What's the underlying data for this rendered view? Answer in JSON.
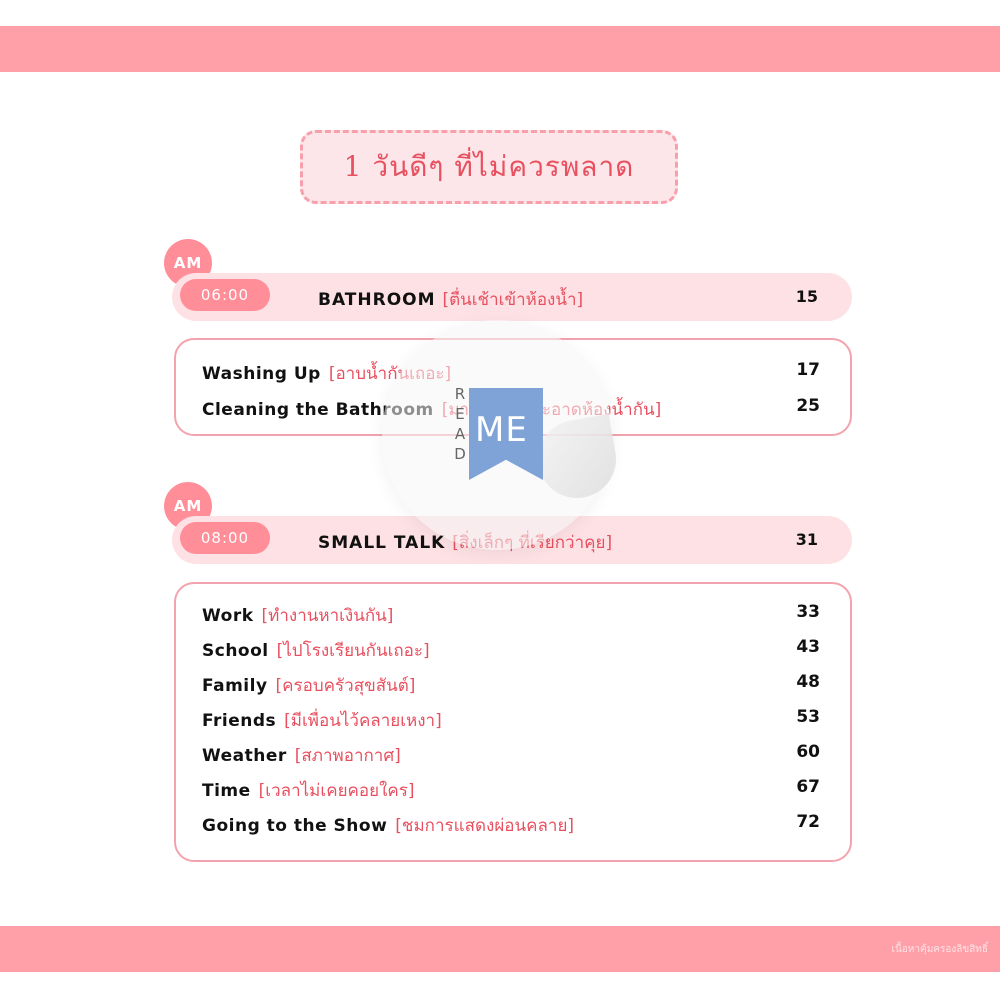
{
  "title": "1 วันดีๆ ที่ไม่ควรพลาด",
  "sections": [
    {
      "am": "AM",
      "time": "06:00",
      "title_en": "BATHROOM",
      "title_th": "[ตื่นเช้าเข้าห้องน้ำ]",
      "page": "15",
      "items": [
        {
          "en": "Washing Up",
          "th": "[อาบน้ำกันเถอะ]",
          "page": "17"
        },
        {
          "en": "Cleaning the Bathroom",
          "th": "[มาทำความสะอาดห้องน้ำกัน]",
          "page": "25"
        }
      ]
    },
    {
      "am": "AM",
      "time": "08:00",
      "title_en": "SMALL TALK",
      "title_th": "[สิ่งเล็กๆ ที่เรียกว่าคุย]",
      "page": "31",
      "items": [
        {
          "en": "Work",
          "th": "[ทำงานหาเงินกัน]",
          "page": "33"
        },
        {
          "en": "School",
          "th": "[ไปโรงเรียนกันเถอะ]",
          "page": "43"
        },
        {
          "en": "Family",
          "th": "[ครอบครัวสุขสันต์]",
          "page": "48"
        },
        {
          "en": "Friends",
          "th": "[มีเพื่อนไว้คลายเหงา]",
          "page": "53"
        },
        {
          "en": "Weather",
          "th": "[สภาพอากาศ]",
          "page": "60"
        },
        {
          "en": "Time",
          "th": "[เวลาไม่เคยคอยใคร]",
          "page": "67"
        },
        {
          "en": "Going to the Show",
          "th": "[ชมการแสดงผ่อนคลาย]",
          "page": "72"
        }
      ]
    }
  ],
  "watermark": {
    "brand": "ME",
    "read_letters": [
      "R",
      "E",
      "A",
      "D"
    ]
  },
  "footer_note": "เนื้อหาคุ้มครองลิขสิทธิ์",
  "colors": {
    "band": "#ff9fa8",
    "accent": "#ff8e99",
    "thai_text": "#e8505f",
    "light_fill": "#fde1e5"
  }
}
